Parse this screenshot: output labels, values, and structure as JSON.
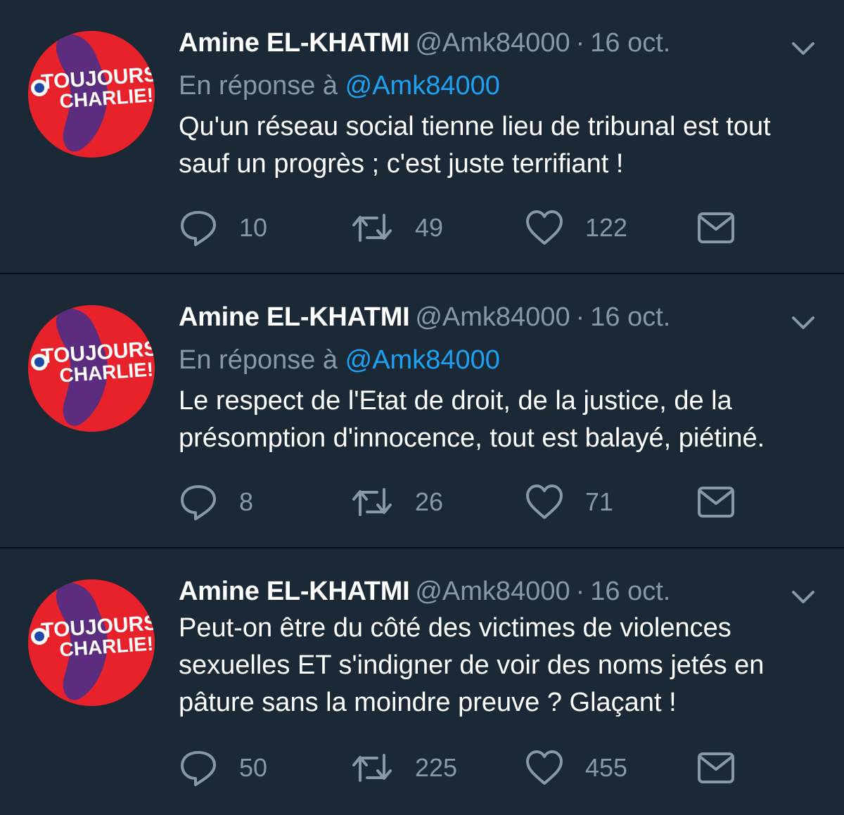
{
  "tweets": [
    {
      "author_name": "Amine EL-KHATMI",
      "handle": "@Amk84000",
      "separator": "·",
      "date": "16 oct.",
      "reply_prefix": "En réponse à",
      "reply_to": "@Amk84000",
      "text_lines": [
        "Qu'un réseau social tienne lieu de tribunal est tout",
        "sauf un progrès ; c'est juste terrifiant !"
      ],
      "replies": "10",
      "retweets": "49",
      "likes": "122"
    },
    {
      "author_name": "Amine EL-KHATMI",
      "handle": "@Amk84000",
      "separator": "·",
      "date": "16 oct.",
      "reply_prefix": "En réponse à",
      "reply_to": "@Amk84000",
      "text_lines": [
        "Le respect de l'Etat de droit, de la justice, de la",
        "présomption d'innocence, tout est balayé, piétiné."
      ],
      "replies": "8",
      "retweets": "26",
      "likes": "71"
    },
    {
      "author_name": "Amine EL-KHATMI",
      "handle": "@Amk84000",
      "separator": "·",
      "date": "16 oct.",
      "text_lines": [
        "Peut-on être du côté des victimes de violences",
        "sexuelles ET s'indigner de voir des noms jetés en",
        "pâture sans la moindre preuve ? Glaçant !"
      ],
      "replies": "50",
      "retweets": "225",
      "likes": "455"
    }
  ],
  "avatar": {
    "line1": "TOUJOURS",
    "line2": "CHARLIE!",
    "colors": {
      "background": "#e8222b",
      "shape": "#5c2d7e",
      "text": "#ffffff",
      "ring_blue": "#1f4aa8"
    }
  },
  "icons": {
    "reply": "reply-bubble-icon",
    "retweet": "retweet-icon",
    "like": "heart-icon",
    "dm": "envelope-icon",
    "menu": "chevron-down-icon"
  },
  "colors": {
    "background": "#1b2836",
    "separator": "#0b0f14",
    "primary_text": "#ffffff",
    "secondary_text": "#8899a6",
    "link": "#1da1f2"
  }
}
